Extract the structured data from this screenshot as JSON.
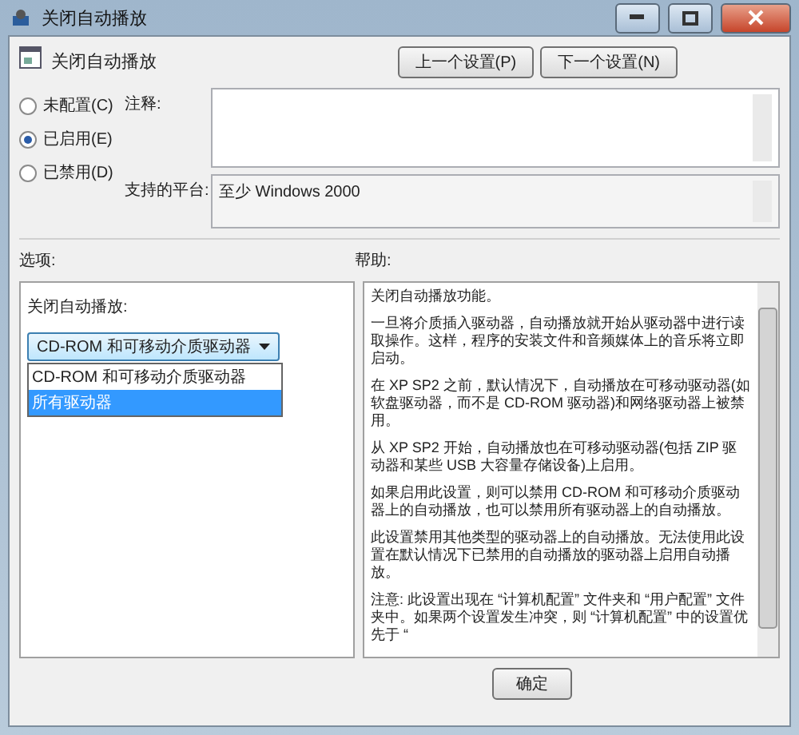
{
  "window": {
    "title": "关闭自动播放"
  },
  "header": {
    "title": "关闭自动播放"
  },
  "nav_buttons": [
    "上一个设置(P)",
    "下一个设置(N)"
  ],
  "state_options": [
    {
      "label": "未配置(C)",
      "selected": false
    },
    {
      "label": "已启用(E)",
      "selected": true
    },
    {
      "label": "已禁用(D)",
      "selected": false
    }
  ],
  "comment": {
    "label": "注释:"
  },
  "platform": {
    "label": "支持的平台:",
    "value": "至少 Windows 2000"
  },
  "options": {
    "heading": "选项:",
    "setting_label": "关闭自动播放:",
    "dropdown": {
      "value": "CD-ROM 和可移动介质驱动器",
      "expanded": true,
      "items": [
        {
          "label": "CD-ROM 和可移动介质驱动器",
          "highlighted": false
        },
        {
          "label": "所有驱动器",
          "highlighted": true
        }
      ]
    }
  },
  "help": {
    "heading": "帮助:",
    "paragraphs": [
      "关闭自动播放功能。",
      "一旦将介质插入驱动器，自动播放就开始从驱动器中进行读取操作。这样，程序的安装文件和音频媒体上的音乐将立即启动。",
      "在 XP SP2 之前，默认情况下，自动播放在可移动驱动器(如软盘驱动器，而不是 CD-ROM 驱动器)和网络驱动器上被禁用。",
      "从 XP SP2 开始，自动播放也在可移动驱动器(包括 ZIP 驱动器和某些 USB 大容量存储设备)上启用。",
      "如果启用此设置，则可以禁用 CD-ROM 和可移动介质驱动器上的自动播放，也可以禁用所有驱动器上的自动播放。",
      "此设置禁用其他类型的驱动器上的自动播放。无法使用此设置在默认情况下已禁用的自动播放的驱动器上启用自动播放。",
      "注意: 此设置出现在 “计算机配置” 文件夹和 “用户配置” 文件夹中。如果两个设置发生冲突，则 “计算机配置” 中的设置优先于 “"
    ]
  },
  "buttons": [
    "确定"
  ]
}
